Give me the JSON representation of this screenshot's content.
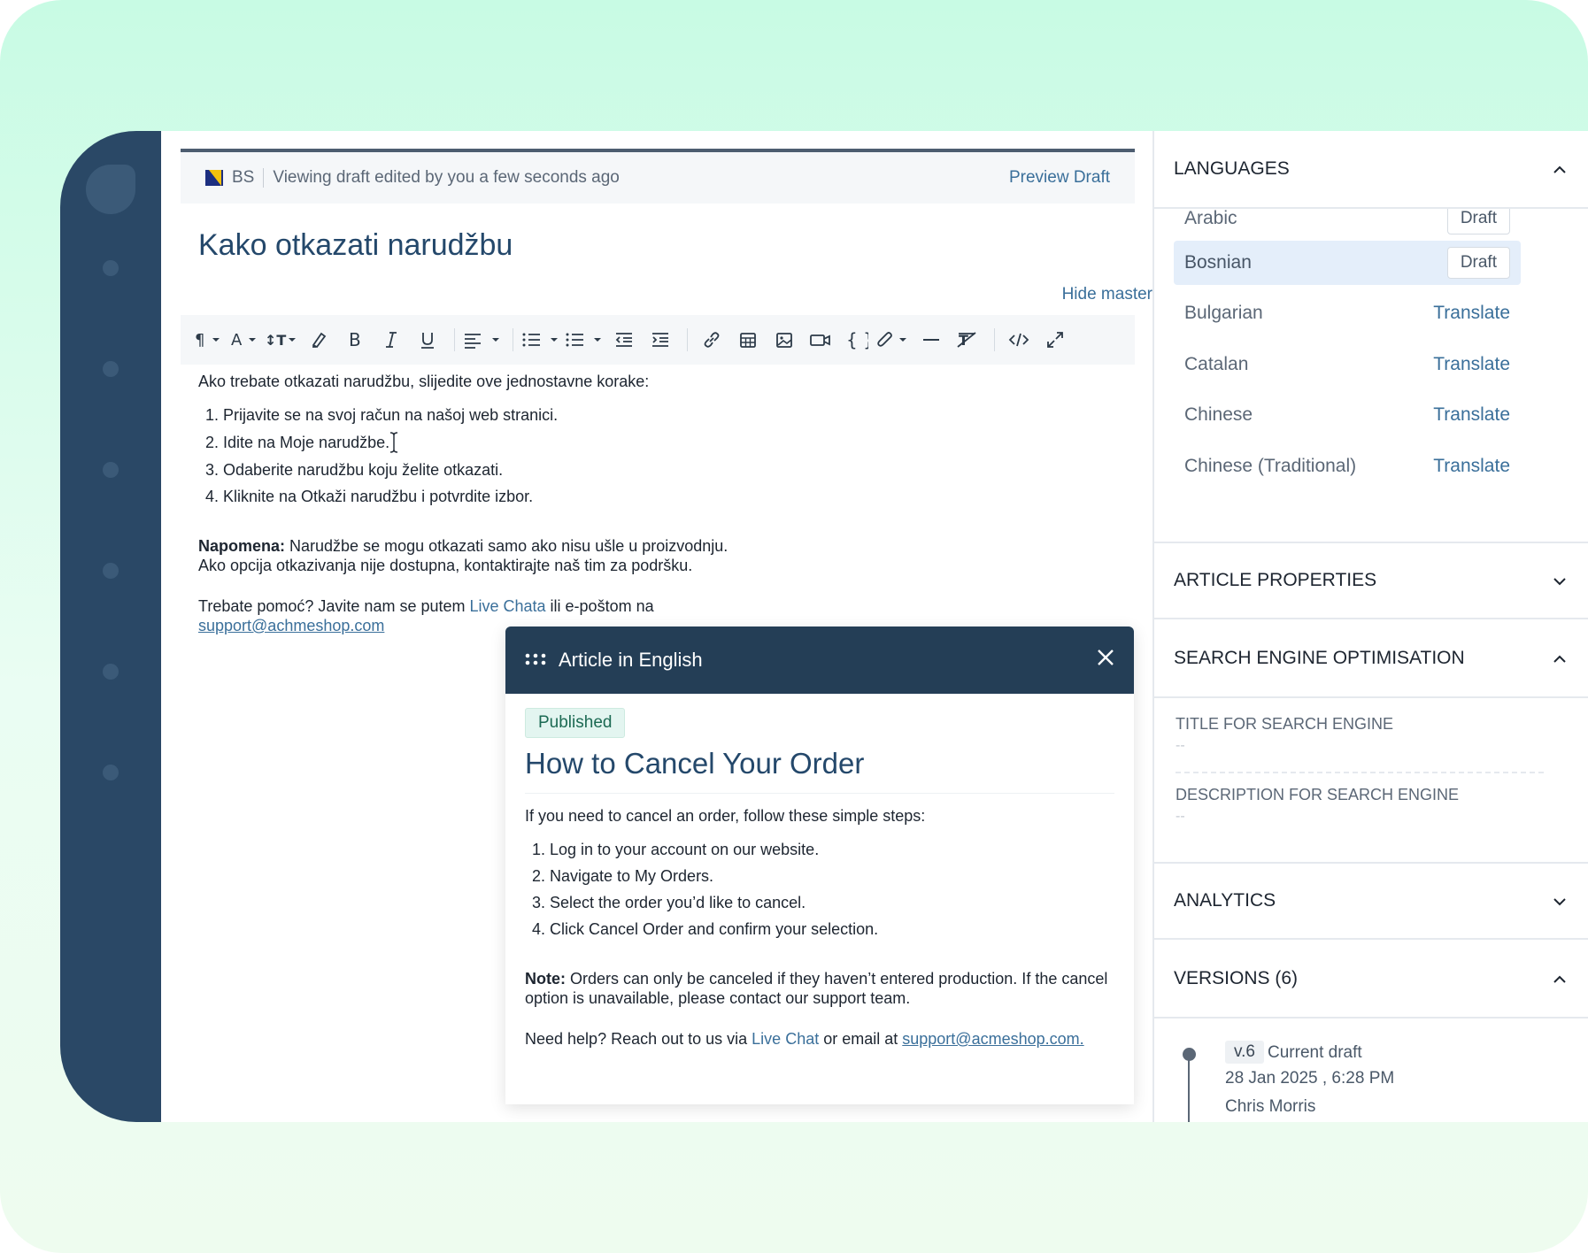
{
  "banner": {
    "lang_code": "BS",
    "status_text": "Viewing draft edited by you a few seconds ago",
    "preview_label": "Preview Draft"
  },
  "article": {
    "title": "Kako otkazati narudžbu",
    "hide_master_label": "Hide master",
    "intro": "Ako trebate otkazati narudžbu, slijedite ove jednostavne korake:",
    "steps": [
      "Prijavite se na svoj račun na našoj web stranici.",
      "Idite na Moje narudžbe.",
      "Odaberite narudžbu koju želite otkazati.",
      "Kliknite na Otkaži narudžbu i potvrdite izbor."
    ],
    "note_label": "Napomena:",
    "note_text": " Narudžbe se mogu otkazati samo ako nisu ušle u proizvodnju.",
    "note_text2": "Ako opcija otkazivanja nije dostupna, kontaktirajte naš tim za podršku.",
    "help_prefix": "Trebate pomoć? Javite nam se putem ",
    "help_link": "Live Chata",
    "help_mid": " ili e-poštom na",
    "help_email": "support@achmeshop.com"
  },
  "toolbar": {
    "icons": [
      "paragraph-icon",
      "font-color-icon",
      "font-size-icon",
      "highlighter-icon",
      "bold-icon",
      "italic-icon",
      "underline-icon",
      "align-icon",
      "bullet-list-icon",
      "numbered-list-icon",
      "outdent-icon",
      "indent-icon",
      "link-icon",
      "table-icon",
      "image-icon",
      "video-icon",
      "code-block-icon",
      "attachment-icon",
      "horizontal-rule-icon",
      "clear-format-icon",
      "html-icon",
      "fullscreen-icon"
    ]
  },
  "overlay": {
    "header": "Article in English",
    "status": "Published",
    "title": "How to Cancel Your Order",
    "intro": "If you need to cancel an order, follow these simple steps:",
    "steps": [
      "Log in to your account on our website.",
      "Navigate to My Orders.",
      "Select the order you’d like to cancel.",
      "Click Cancel Order and confirm your selection."
    ],
    "note_label": "Note:",
    "note_text": " Orders can only be canceled if they haven’t entered production. If the cancel option is unavailable, please contact our support team.",
    "help_prefix": "Need help? Reach out to us via ",
    "help_link": "Live Chat",
    "help_mid": " or email at ",
    "help_email": "support@acmeshop.com."
  },
  "right_panel": {
    "languages_title": "LANGUAGES",
    "languages": [
      {
        "name": "Arabic",
        "action": "Draft",
        "state": "draft"
      },
      {
        "name": "Bosnian",
        "action": "Draft",
        "state": "active"
      },
      {
        "name": "Bulgarian",
        "action": "Translate",
        "state": "translate"
      },
      {
        "name": "Catalan",
        "action": "Translate",
        "state": "translate"
      },
      {
        "name": "Chinese",
        "action": "Translate",
        "state": "translate"
      },
      {
        "name": "Chinese (Traditional)",
        "action": "Translate",
        "state": "translate"
      }
    ],
    "article_properties_title": "ARTICLE PROPERTIES",
    "seo_title": "SEARCH ENGINE OPTIMISATION",
    "seo_title_field_label": "TITLE FOR SEARCH ENGINE",
    "seo_title_field_value": "--",
    "seo_desc_field_label": "DESCRIPTION FOR SEARCH ENGINE",
    "seo_desc_field_value": "--",
    "analytics_title": "ANALYTICS",
    "versions_title": "VERSIONS (6)",
    "version": {
      "tag": "v.6",
      "label": "Current draft",
      "date": "28 Jan 2025 , 6:28 PM",
      "author": "Chris Morris"
    }
  },
  "colors": {
    "sidebar": "#2a4866",
    "overlay_header": "#243e56",
    "link": "#3a6f9a",
    "title": "#24486b"
  }
}
